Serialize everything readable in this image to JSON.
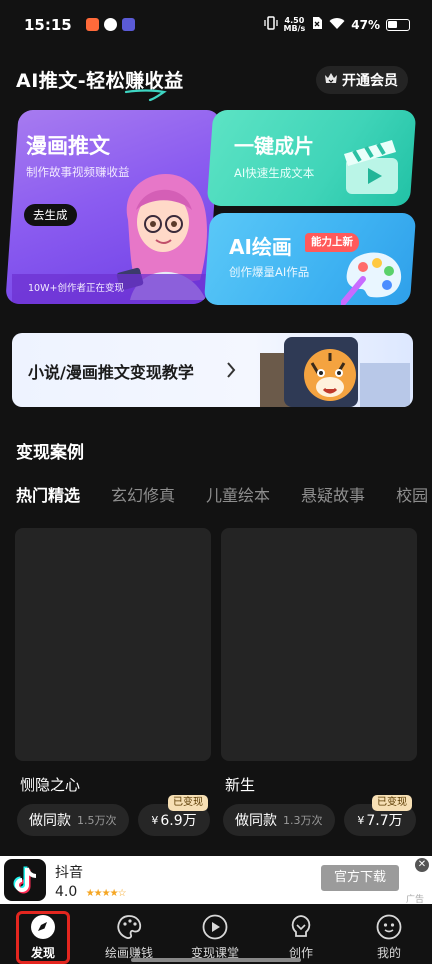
{
  "status_bar": {
    "time": "15:15",
    "speed_value": "4.50",
    "speed_unit": "MB/s",
    "battery": "47%"
  },
  "header": {
    "title": "AI推文-轻松赚收益",
    "vip_label": "开通会员"
  },
  "feature_cards": {
    "comic": {
      "title": "漫画推文",
      "subtitle": "制作故事视频赚收益",
      "button": "去生成",
      "footer": "10W+创作者正在变现"
    },
    "oneclick": {
      "title": "一键成片",
      "subtitle": "AI快速生成文本"
    },
    "aidraw": {
      "title": "AI绘画",
      "badge": "能力上新",
      "subtitle": "创作爆量AI作品"
    }
  },
  "tutorial_banner": {
    "label": "小说/漫画推文变现教学"
  },
  "cases": {
    "section_title": "变现案例",
    "tabs": [
      "热门精选",
      "玄幻修真",
      "儿童绘本",
      "悬疑故事",
      "校园"
    ],
    "items": [
      {
        "name": "恻隐之心",
        "same_label": "做同款",
        "count": "1.5万次",
        "earn_tag": "已变现",
        "yen": "¥",
        "earn": "6.9万"
      },
      {
        "name": "新生",
        "same_label": "做同款",
        "count": "1.3万次",
        "earn_tag": "已变现",
        "yen": "¥",
        "earn": "7.7万"
      }
    ]
  },
  "ad": {
    "app_name": "抖音",
    "rating": "4.0",
    "download_label": "官方下载",
    "ad_label": "广告",
    "close": "✕"
  },
  "tabbar": {
    "items": [
      {
        "label": "发现",
        "icon": "compass-icon"
      },
      {
        "label": "绘画赚钱",
        "icon": "palette-icon"
      },
      {
        "label": "变现课堂",
        "icon": "play-circle-icon"
      },
      {
        "label": "创作",
        "icon": "bulb-icon"
      },
      {
        "label": "我的",
        "icon": "smile-icon"
      }
    ]
  },
  "colors": {
    "accent": "#3ed6c3",
    "highlight": "#e3261f",
    "comic_card": "#8b5cf0",
    "oneclick_card": "#3fd4b8",
    "aidraw_card": "#3eb2f2"
  }
}
